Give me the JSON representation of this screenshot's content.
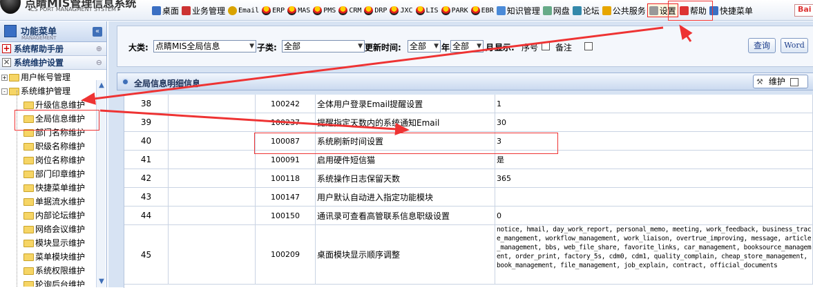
{
  "app": {
    "title": "点睛MIS管理信息系统",
    "subtitle": "◂CS PORT MANAGMENT SYSTEM ▸"
  },
  "topmenu": [
    {
      "label": "桌面",
      "icon": "desktop-icon",
      "color": "#3b6fc3"
    },
    {
      "label": "业务管理",
      "icon": "business-icon",
      "color": "#c33"
    },
    {
      "label": "Email",
      "icon": "email-icon",
      "color": "#d9a300",
      "sys": true
    },
    {
      "label": "ERP",
      "icon": "erp-icon",
      "sys": true
    },
    {
      "label": "MAS",
      "icon": "mas-icon",
      "sys": true
    },
    {
      "label": "PMS",
      "icon": "pms-icon",
      "sys": true
    },
    {
      "label": "CRM",
      "icon": "crm-icon",
      "sys": true
    },
    {
      "label": "DRP",
      "icon": "drp-icon",
      "sys": true
    },
    {
      "label": "JXC",
      "icon": "jxc-icon",
      "sys": true
    },
    {
      "label": "LIS",
      "icon": "lis-icon",
      "sys": true
    },
    {
      "label": "PARK",
      "icon": "park-icon",
      "sys": true
    },
    {
      "label": "EBR",
      "icon": "ebr-icon",
      "sys": true
    },
    {
      "label": "知识管理",
      "icon": "knowledge-icon",
      "color": "#4a8ad8"
    },
    {
      "label": "网盘",
      "icon": "netdisk-icon",
      "color": "#6a8"
    },
    {
      "label": "论坛",
      "icon": "forum-icon",
      "color": "#38a"
    },
    {
      "label": "公共服务",
      "icon": "public-service-icon",
      "color": "#e7a600"
    },
    {
      "label": "设置",
      "icon": "settings-icon",
      "color": "#999",
      "highlight": true
    },
    {
      "label": "帮助",
      "icon": "help-icon",
      "color": "#d33"
    },
    {
      "label": "快捷菜单",
      "icon": "shortcut-icon",
      "color": "#3b6fc3"
    }
  ],
  "baidu": "Bai",
  "sidebar": {
    "title": "功能菜单",
    "subtitle": "MANAGEMENT",
    "collapse": "«",
    "sections": [
      {
        "label": "系统帮助手册",
        "expand": "⊕"
      },
      {
        "label": "系统维护设置",
        "expand": "⊖"
      }
    ],
    "tree": [
      {
        "label": "用户帐号管理",
        "level": 0,
        "toggle": "+"
      },
      {
        "label": "系统维护管理",
        "level": 0,
        "toggle": "-"
      },
      {
        "label": "升级信息维护",
        "level": 1
      },
      {
        "label": "全局信息维护",
        "level": 1,
        "highlight": true
      },
      {
        "label": "部门名称维护",
        "level": 1
      },
      {
        "label": "职级名称维护",
        "level": 1
      },
      {
        "label": "岗位名称维护",
        "level": 1
      },
      {
        "label": "部门印章维护",
        "level": 1
      },
      {
        "label": "快捷菜单维护",
        "level": 1
      },
      {
        "label": "单据流水维护",
        "level": 1
      },
      {
        "label": "内部论坛维护",
        "level": 1
      },
      {
        "label": "网络会议维护",
        "level": 1
      },
      {
        "label": "模块显示维护",
        "level": 1
      },
      {
        "label": "菜单模块维护",
        "level": 1
      },
      {
        "label": "系统权限维护",
        "level": 1
      },
      {
        "label": "轮询后台维护",
        "level": 1
      }
    ]
  },
  "filter": {
    "category_label": "大类:",
    "category_value": "点睛MIS全局信息",
    "subcategory_label": "子类:",
    "subcategory_value": "全部",
    "update_label": "更新时间:",
    "update_value": "全部",
    "year_label": "年",
    "year_value": "全部",
    "month_label": "月",
    "show_label": "显示:",
    "seq_label": "序号",
    "note_label": "备注",
    "query_button": "查询",
    "word_button": "Word"
  },
  "panel": {
    "title": "全局信息明细信息",
    "maintain_button": "维护"
  },
  "table": {
    "rows": [
      {
        "idx": "38",
        "code": "100242",
        "name": "全体用户登录Email提醒设置",
        "value": "1"
      },
      {
        "idx": "39",
        "code": "100237",
        "name": "提醒指定天数内的系统通知Email",
        "value": "30"
      },
      {
        "idx": "40",
        "code": "100087",
        "name": "系统刷新时间设置",
        "value": "3",
        "highlight": true
      },
      {
        "idx": "41",
        "code": "100091",
        "name": "启用硬件短信猫",
        "value": "是"
      },
      {
        "idx": "42",
        "code": "100118",
        "name": "系统操作日志保留天数",
        "value": "365"
      },
      {
        "idx": "43",
        "code": "100147",
        "name": "用户默认自动进入指定功能模块",
        "value": ""
      },
      {
        "idx": "44",
        "code": "100150",
        "name": "通讯录可查看高管联系信息职级设置",
        "value": "0"
      },
      {
        "idx": "45",
        "code": "100209",
        "name": "桌面模块显示顺序调整",
        "value": "notice, hmail, day_work_report, personal_memo, meeting, work_feedback, business_trace_mangement, workflow_management, work_liaison, overtrue_improving, message, article_management, bbs, web_file_share, favorite_links, car_management, booksource_management, order_print, factory_5s, cdm0, cdm1, quality_complain, cheap_store_management, book_management, file_management, job_explain, contract, official_documents",
        "long": true
      }
    ]
  },
  "colors": {
    "accent": "#3f6fb8",
    "annotation": "#e33"
  }
}
